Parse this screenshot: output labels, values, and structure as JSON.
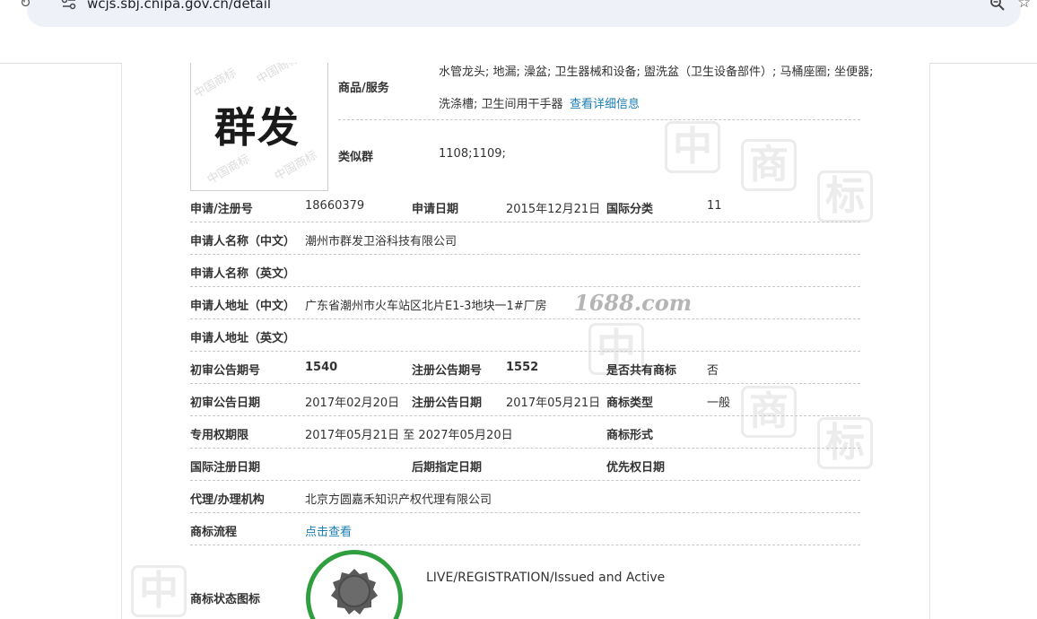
{
  "browser": {
    "url": "wcjs.sbj.cnipa.gov.cn/detail"
  },
  "trademark": {
    "image_text": "群发",
    "stamp_text": "中国商标"
  },
  "goods": {
    "label": "商品/服务",
    "line1": "水管龙头; 地漏; 澡盆; 卫生器械和设备; 盥洗盆（卫生设备部件）; 马桶座圈; 坐便器;",
    "line2": "洗涤槽; 卫生间用干手器",
    "link": "查看详细信息"
  },
  "similar_group": {
    "label": "类似群",
    "value": "1108;1109;"
  },
  "rows": {
    "reg_no_label": "申请/注册号",
    "reg_no": "18660379",
    "app_date_label": "申请日期",
    "app_date": "2015年12月21日",
    "intl_class_label": "国际分类",
    "intl_class": "11",
    "applicant_cn_label": "申请人名称（中文）",
    "applicant_cn": "潮州市群发卫浴科技有限公司",
    "applicant_en_label": "申请人名称（英文）",
    "address_cn_label": "申请人地址（中文）",
    "address_cn": "广东省潮州市火车站区北片E1-3地块一1#厂房",
    "address_en_label": "申请人地址（英文）",
    "prelim_issue_label": "初审公告期号",
    "prelim_issue": "1540",
    "reg_issue_label": "注册公告期号",
    "reg_issue": "1552",
    "shared_label": "是否共有商标",
    "shared": "否",
    "prelim_date_label": "初审公告日期",
    "prelim_date": "2017年02月20日",
    "reg_date_label": "注册公告日期",
    "reg_date": "2017年05月21日",
    "tm_type_label": "商标类型",
    "tm_type": "一般",
    "term_label": "专用权期限",
    "term": "2017年05月21日 至 2027年05月20日",
    "tm_form_label": "商标形式",
    "intl_reg_date_label": "国际注册日期",
    "later_date_label": "后期指定日期",
    "priority_date_label": "优先权日期",
    "agent_label": "代理/办理机构",
    "agent": "北京方圆嘉禾知识产权代理有限公司",
    "flow_label": "商标流程",
    "flow_link": "点击查看",
    "status_label": "商标状态图标",
    "status_text": "LIVE/REGISTRATION/Issued and Active"
  },
  "watermark": {
    "text": "1688.com"
  },
  "colors": {
    "link": "#1a7eb5",
    "seal": "#2e9e3e"
  },
  "icons": [
    "reload-icon",
    "site-info-icon",
    "zoom-icon",
    "star-icon",
    "status-seal-icon"
  ]
}
